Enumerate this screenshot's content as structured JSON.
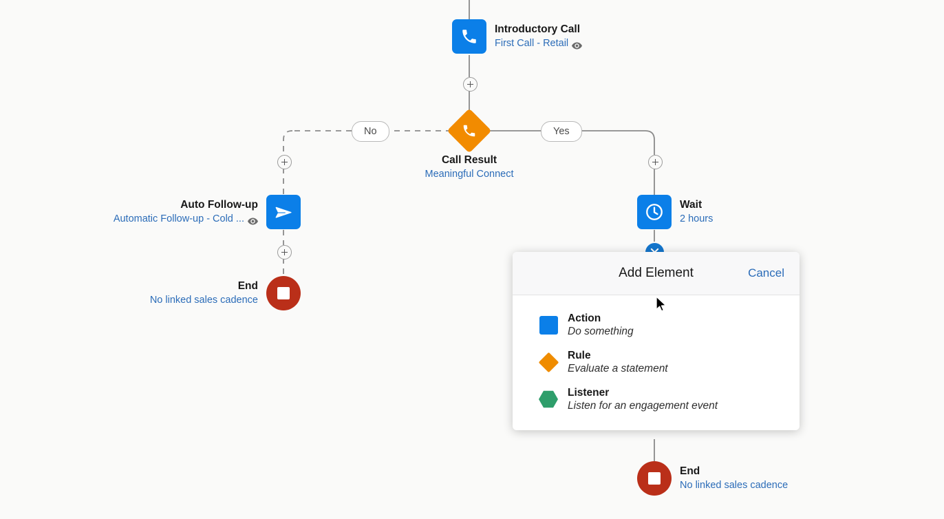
{
  "canvas": {
    "background": "#fafaf9",
    "accent_blue": "#0b7fe8",
    "accent_orange": "#f28b00",
    "accent_red": "#ba2f19",
    "accent_green": "#2e9e6b",
    "link_blue": "#2b6cb8"
  },
  "nodes": {
    "intro_call": {
      "title": "Introductory Call",
      "subtitle": "First Call - Retail",
      "icon": "phone-icon",
      "shape": "square",
      "has_preview_eye": true
    },
    "call_result": {
      "title": "Call Result",
      "subtitle": "Meaningful Connect",
      "icon": "phone-icon",
      "shape": "diamond",
      "has_preview_eye": false
    },
    "auto_followup": {
      "title": "Auto Follow-up",
      "subtitle": "Automatic Follow-up - Cold ...",
      "icon": "send-icon",
      "shape": "square",
      "has_preview_eye": true
    },
    "end_left": {
      "title": "End",
      "subtitle": "No linked sales cadence",
      "icon": "stop-icon",
      "shape": "circle",
      "has_preview_eye": false
    },
    "wait": {
      "title": "Wait",
      "subtitle": "2 hours",
      "icon": "clock-icon",
      "shape": "square",
      "has_preview_eye": false
    },
    "end_right": {
      "title": "End",
      "subtitle": "No linked sales cadence",
      "icon": "stop-icon",
      "shape": "circle",
      "has_preview_eye": false
    }
  },
  "branches": {
    "no_label": "No",
    "yes_label": "Yes"
  },
  "popup": {
    "title": "Add Element",
    "cancel_label": "Cancel",
    "options": [
      {
        "name": "Action",
        "desc": "Do something",
        "mark": "blue-square-icon"
      },
      {
        "name": "Rule",
        "desc": "Evaluate a statement",
        "mark": "orange-diamond-icon"
      },
      {
        "name": "Listener",
        "desc": "Listen for an engagement event",
        "mark": "green-hexagon-icon"
      }
    ]
  }
}
